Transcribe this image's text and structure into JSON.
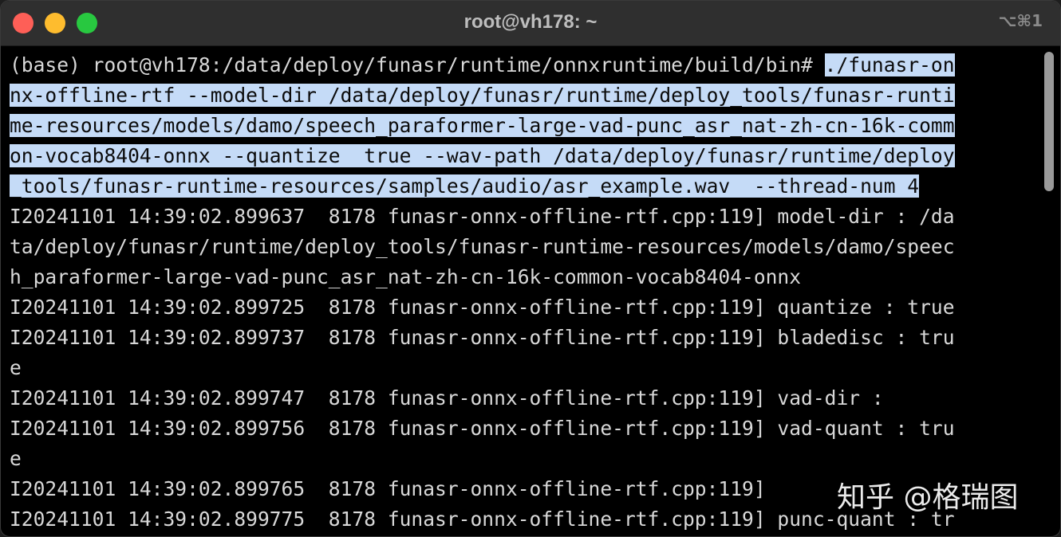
{
  "window": {
    "title": "root@vh178: ~",
    "shortcut": "⌥⌘1"
  },
  "terminal": {
    "prompt": "(base) root@vh178:/data/deploy/funasr/runtime/onnxruntime/build/bin# ",
    "command": [
      "./funasr-on",
      "nx-offline-rtf --model-dir /data/deploy/funasr/runtime/deploy_tools/funasr-runti",
      "me-resources/models/damo/speech_paraformer-large-vad-punc_asr_nat-zh-cn-16k-comm",
      "on-vocab8404-onnx --quantize  true --wav-path /data/deploy/funasr/runtime/deploy",
      "_tools/funasr-runtime-resources/samples/audio/asr_example.wav  --thread-num 4"
    ],
    "output": [
      "I20241101 14:39:02.899637  8178 funasr-onnx-offline-rtf.cpp:119] model-dir : /da",
      "ta/deploy/funasr/runtime/deploy_tools/funasr-runtime-resources/models/damo/speec",
      "h_paraformer-large-vad-punc_asr_nat-zh-cn-16k-common-vocab8404-onnx",
      "I20241101 14:39:02.899725  8178 funasr-onnx-offline-rtf.cpp:119] quantize : true",
      "I20241101 14:39:02.899737  8178 funasr-onnx-offline-rtf.cpp:119] bladedisc : tru",
      "e",
      "I20241101 14:39:02.899747  8178 funasr-onnx-offline-rtf.cpp:119] vad-dir :",
      "I20241101 14:39:02.899756  8178 funasr-onnx-offline-rtf.cpp:119] vad-quant : tru",
      "e",
      "I20241101 14:39:02.899765  8178 funasr-onnx-offline-rtf.cpp:119]",
      "I20241101 14:39:02.899775  8178 funasr-onnx-offline-rtf.cpp:119] punc-quant : tr"
    ]
  },
  "watermark": "知乎 @格瑞图",
  "colors": {
    "background": "#000000",
    "text": "#d8d8d8",
    "selection": "#c5dbf7",
    "titlebar": "#2f2f2f"
  }
}
